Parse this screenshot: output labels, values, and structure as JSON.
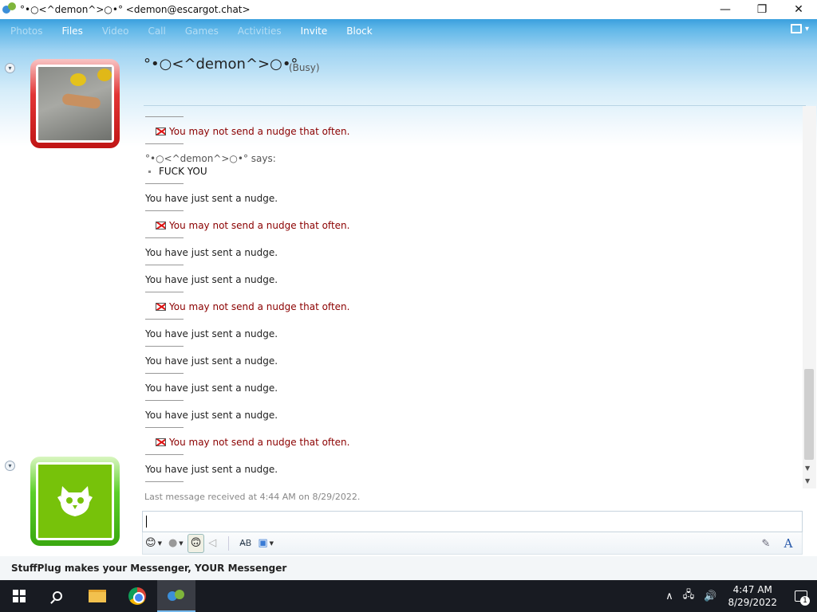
{
  "window": {
    "title": "°•○<^demon^>○•° <demon@escargot.chat>",
    "minimize": "—",
    "maximize": "❐",
    "close": "✕"
  },
  "menu": {
    "items": [
      "Photos",
      "Files",
      "Video",
      "Call",
      "Games",
      "Activities",
      "Invite",
      "Block"
    ]
  },
  "contact": {
    "name": "°•○<^demon^>○•°",
    "status": "(Busy)"
  },
  "conversation": {
    "warning_text": "You may not send a nudge that often.",
    "nudge_text": "You have just sent a nudge.",
    "says_label": "°•○<^demon^>○•° says:",
    "received_message": "FUCK YOU",
    "last_message": "Last message received at 4:44 AM on 8/29/2022."
  },
  "toolbar": {
    "emoticon_icon": "smiley-icon",
    "wink_icon": "wink-icon",
    "nudge_icon": "nudge-icon",
    "voice_clip_icon": "voice-clip-icon",
    "font_label": "A"
  },
  "ad": {
    "text": "StuffPlug makes your Messenger, YOUR Messenger"
  },
  "taskbar": {
    "time": "4:47 AM",
    "date": "8/29/2022",
    "notification_count": "1"
  },
  "colors": {
    "header_blue": "#3aa0de",
    "busy_red": "#e23535",
    "online_green": "#5cd02a",
    "warning_text": "#8b0000"
  }
}
